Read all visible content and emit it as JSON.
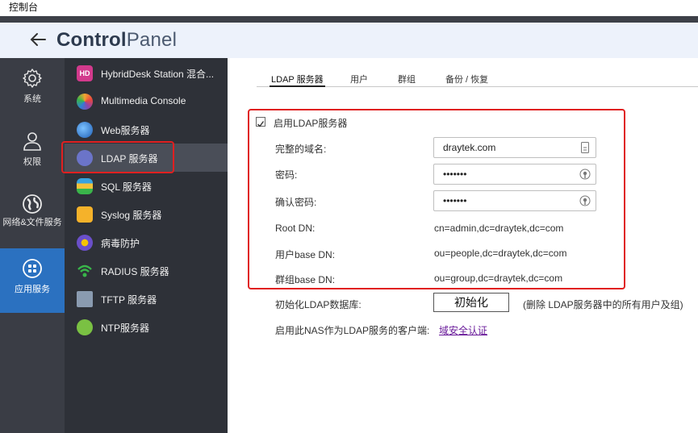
{
  "window": {
    "title": "控制台"
  },
  "header": {
    "brand_bold": "Control",
    "brand_light": "Panel"
  },
  "leftnav": {
    "items": [
      {
        "label": "系统",
        "icon": "gear-icon"
      },
      {
        "label": "权限",
        "icon": "user-icon"
      },
      {
        "label": "网络&文件服务",
        "icon": "globe-icon"
      },
      {
        "label": "应用服务",
        "icon": "apps-icon",
        "active": true
      }
    ]
  },
  "subnav": {
    "items": [
      {
        "label": "HybridDesk Station 混合...",
        "icon": "hybriddesk-icon",
        "color": "#d23a8c"
      },
      {
        "label": "Multimedia Console",
        "icon": "multimedia-icon",
        "color": "#f2a531"
      },
      {
        "label": "Web服务器",
        "icon": "web-icon",
        "color": "#2f7fd6"
      },
      {
        "label": "LDAP 服务器",
        "icon": "ldap-icon",
        "color": "#6b74c9",
        "active": true
      },
      {
        "label": "SQL 服务器",
        "icon": "sql-icon",
        "color": "#37a3e0"
      },
      {
        "label": "Syslog 服务器",
        "icon": "syslog-icon",
        "color": "#f5b22a"
      },
      {
        "label": "病毒防护",
        "icon": "antivirus-icon",
        "color": "#6a4fc9"
      },
      {
        "label": "RADIUS 服务器",
        "icon": "radius-icon",
        "color": "#39b54a"
      },
      {
        "label": "TFTP 服务器",
        "icon": "tftp-icon",
        "color": "#8a9bb0"
      },
      {
        "label": "NTP服务器",
        "icon": "ntp-icon",
        "color": "#7ac143"
      }
    ]
  },
  "tabs": [
    {
      "label": "LDAP 服务器",
      "active": true
    },
    {
      "label": "用户"
    },
    {
      "label": "群组"
    },
    {
      "label": "备份 / 恢复"
    }
  ],
  "form": {
    "enable_label": "启用LDAP服务器",
    "enable_checked": true,
    "domain_label": "完整的域名:",
    "domain_value": "draytek.com",
    "password_label": "密码:",
    "password_value": "•••••••",
    "confirm_label": "确认密码:",
    "confirm_value": "•••••••",
    "root_dn_label": "Root DN:",
    "root_dn_value": "cn=admin,dc=draytek,dc=com",
    "user_base_label": "用户base DN:",
    "user_base_value": "ou=people,dc=draytek,dc=com",
    "group_base_label": "群组base DN:",
    "group_base_value": "ou=group,dc=draytek,dc=com",
    "init_label": "初始化LDAP数据库:",
    "init_button": "初始化",
    "init_note": "(删除 LDAP服务器中的所有用户及组)",
    "client_label": "启用此NAS作为LDAP服务的客户端:",
    "client_link": "域安全认证"
  },
  "colors": {
    "accent": "#2b71c0",
    "highlight": "#e02020"
  }
}
